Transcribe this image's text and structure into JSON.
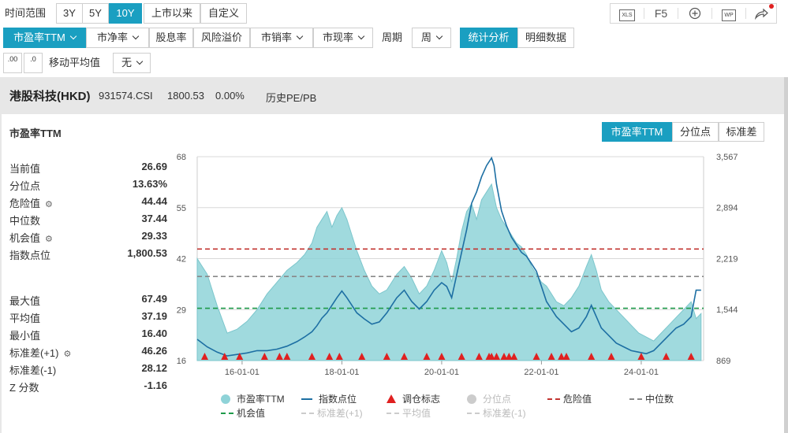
{
  "toolbar": {
    "time_range_label": "时间范围",
    "time_ranges": [
      "3Y",
      "5Y",
      "10Y",
      "上市以来",
      "自定义"
    ],
    "active_range": "10Y",
    "icons": {
      "xls": "XLS",
      "f5": "F5",
      "wp": "WP"
    },
    "metrics": [
      "市盈率TTM",
      "市净率",
      "股息率",
      "风险溢价",
      "市销率",
      "市现率"
    ],
    "period_label": "周期",
    "period_value": "周",
    "view_tabs": [
      "统计分析",
      "明细数据"
    ],
    "decimal_icons": [
      ".00",
      ".0"
    ],
    "ma_label": "移动平均值",
    "ma_value": "无"
  },
  "header": {
    "index_name": "港股科技(HKD)",
    "code": "931574.CSI",
    "price": "1800.53",
    "change": "0.00%",
    "history_link": "历史PE/PB"
  },
  "panel": {
    "title": "市盈率TTM",
    "tabs": [
      "市盈率TTM",
      "分位点",
      "标准差"
    ]
  },
  "stats_top": [
    {
      "label": "当前值",
      "value": "26.69",
      "gear": false
    },
    {
      "label": "分位点",
      "value": "13.63%",
      "gear": false
    },
    {
      "label": "危险值",
      "value": "44.44",
      "gear": true
    },
    {
      "label": "中位数",
      "value": "37.44",
      "gear": false
    },
    {
      "label": "机会值",
      "value": "29.33",
      "gear": true
    },
    {
      "label": "指数点位",
      "value": "1,800.53",
      "gear": false
    }
  ],
  "stats_bottom": [
    {
      "label": "最大值",
      "value": "67.49",
      "gear": false
    },
    {
      "label": "平均值",
      "value": "37.19",
      "gear": false
    },
    {
      "label": "最小值",
      "value": "16.40",
      "gear": false
    },
    {
      "label": "标准差(+1)",
      "value": "46.26",
      "gear": true
    },
    {
      "label": "标准差(-1)",
      "value": "28.12",
      "gear": false
    },
    {
      "label": "Z 分数",
      "value": "-1.16",
      "gear": false
    }
  ],
  "legend": [
    {
      "label": "市盈率TTM",
      "marker": "circle",
      "color": "#8fd3d8",
      "dim": false
    },
    {
      "label": "指数点位",
      "marker": "line",
      "color": "#1d6fa3",
      "dim": false
    },
    {
      "label": "调仓标志",
      "marker": "triangle",
      "color": "#e02020",
      "dim": false
    },
    {
      "label": "分位点",
      "marker": "circle",
      "color": "#cccccc",
      "dim": true
    },
    {
      "label": "危险值",
      "marker": "dash",
      "color": "#c23531",
      "dim": false
    },
    {
      "label": "中位数",
      "marker": "dash",
      "color": "#888888",
      "dim": false
    },
    {
      "label": "机会值",
      "marker": "dash",
      "color": "#1e9a4a",
      "dim": false
    },
    {
      "label": "标准差(+1)",
      "marker": "dash",
      "color": "#cccccc",
      "dim": true
    },
    {
      "label": "平均值",
      "marker": "dash",
      "color": "#cccccc",
      "dim": true
    },
    {
      "label": "标准差(-1)",
      "marker": "dash",
      "color": "#cccccc",
      "dim": true
    }
  ],
  "chart_data": {
    "type": "area",
    "title": "市盈率TTM",
    "x_tick_labels": [
      "16-01-01",
      "18-01-01",
      "20-01-01",
      "22-01-01",
      "24-01-01"
    ],
    "x_tick_years": [
      2016,
      2018,
      2020,
      2022,
      2024
    ],
    "x_range": [
      2015.1,
      2025.25
    ],
    "y_left_range": [
      16,
      68
    ],
    "y_left_ticks": [
      16,
      29,
      42,
      55,
      68
    ],
    "y_right_range": [
      869,
      3567
    ],
    "y_right_ticks": [
      "869",
      "1,544",
      "2,219",
      "2,894",
      "3,567"
    ],
    "grid": true,
    "reference_lines": [
      {
        "name": "危险值",
        "value": 44.44,
        "color": "#c23531"
      },
      {
        "name": "中位数",
        "value": 37.44,
        "color": "#888888"
      },
      {
        "name": "机会值",
        "value": 29.33,
        "color": "#1e9a4a"
      }
    ],
    "series": [
      {
        "name": "市盈率TTM",
        "axis": "left",
        "color": "#8fd3d8",
        "x": [
          2015.1,
          2015.3,
          2015.5,
          2015.7,
          2015.9,
          2016.1,
          2016.3,
          2016.5,
          2016.7,
          2016.9,
          2017.1,
          2017.25,
          2017.4,
          2017.5,
          2017.6,
          2017.7,
          2017.8,
          2017.9,
          2018.0,
          2018.1,
          2018.2,
          2018.3,
          2018.45,
          2018.6,
          2018.75,
          2018.9,
          2019.0,
          2019.1,
          2019.25,
          2019.4,
          2019.55,
          2019.7,
          2019.85,
          2020.0,
          2020.1,
          2020.2,
          2020.3,
          2020.4,
          2020.5,
          2020.6,
          2020.7,
          2020.8,
          2020.9,
          2021.0,
          2021.05,
          2021.1,
          2021.2,
          2021.3,
          2021.4,
          2021.5,
          2021.6,
          2021.7,
          2021.8,
          2021.9,
          2022.0,
          2022.1,
          2022.2,
          2022.3,
          2022.45,
          2022.6,
          2022.75,
          2022.9,
          2023.0,
          2023.1,
          2023.2,
          2023.35,
          2023.5,
          2023.65,
          2023.8,
          2023.95,
          2024.1,
          2024.25,
          2024.4,
          2024.55,
          2024.7,
          2024.85,
          2025.0,
          2025.1,
          2025.2
        ],
        "values": [
          42,
          38,
          30,
          23,
          24,
          26,
          29,
          33,
          36,
          39,
          41,
          43,
          46,
          50,
          52,
          54,
          50,
          53,
          55,
          52,
          48,
          44,
          39,
          35,
          33,
          34,
          36,
          38,
          40,
          37,
          33,
          35,
          39,
          44,
          41,
          36,
          42,
          49,
          54,
          56,
          52,
          57,
          59,
          61,
          58,
          55,
          52,
          50,
          48,
          46,
          45,
          43,
          40,
          38,
          36,
          35,
          33,
          31,
          30,
          32,
          35,
          40,
          43,
          39,
          34,
          31,
          29,
          27,
          25,
          23,
          22,
          21,
          23,
          25,
          27,
          29,
          31,
          26.7,
          28
        ]
      },
      {
        "name": "指数点位",
        "axis": "right",
        "color": "#1d6fa3",
        "x": [
          2015.1,
          2015.3,
          2015.5,
          2015.7,
          2015.9,
          2016.1,
          2016.3,
          2016.5,
          2016.7,
          2016.9,
          2017.1,
          2017.25,
          2017.4,
          2017.5,
          2017.6,
          2017.7,
          2017.8,
          2017.9,
          2018.0,
          2018.1,
          2018.2,
          2018.3,
          2018.45,
          2018.6,
          2018.75,
          2018.9,
          2019.0,
          2019.1,
          2019.25,
          2019.4,
          2019.55,
          2019.7,
          2019.85,
          2020.0,
          2020.1,
          2020.2,
          2020.3,
          2020.4,
          2020.5,
          2020.6,
          2020.7,
          2020.8,
          2020.9,
          2021.0,
          2021.05,
          2021.1,
          2021.2,
          2021.3,
          2021.4,
          2021.5,
          2021.6,
          2021.7,
          2021.8,
          2021.9,
          2022.0,
          2022.1,
          2022.2,
          2022.3,
          2022.45,
          2022.6,
          2022.75,
          2022.9,
          2023.0,
          2023.1,
          2023.2,
          2023.35,
          2023.5,
          2023.65,
          2023.8,
          2023.95,
          2024.1,
          2024.25,
          2024.4,
          2024.55,
          2024.7,
          2024.85,
          2025.0,
          2025.1,
          2025.2
        ],
        "values": [
          1150,
          1050,
          980,
          930,
          950,
          970,
          1000,
          1000,
          1020,
          1060,
          1120,
          1180,
          1250,
          1330,
          1430,
          1500,
          1600,
          1700,
          1790,
          1700,
          1600,
          1500,
          1420,
          1350,
          1380,
          1500,
          1600,
          1700,
          1800,
          1650,
          1550,
          1650,
          1800,
          1900,
          1850,
          1700,
          2000,
          2300,
          2600,
          2950,
          3100,
          3300,
          3450,
          3550,
          3450,
          3200,
          2850,
          2650,
          2500,
          2400,
          2300,
          2250,
          2150,
          2050,
          1850,
          1650,
          1550,
          1450,
          1350,
          1250,
          1300,
          1450,
          1600,
          1450,
          1300,
          1200,
          1100,
          1050,
          1000,
          980,
          960,
          1000,
          1100,
          1200,
          1300,
          1350,
          1450,
          1800,
          1800
        ]
      },
      {
        "name": "调仓标志",
        "axis": "marker",
        "x": [
          2015.25,
          2015.65,
          2015.95,
          2016.45,
          2016.75,
          2016.9,
          2017.4,
          2017.75,
          2017.95,
          2018.4,
          2018.9,
          2019.25,
          2019.7,
          2020.0,
          2020.4,
          2020.75,
          2020.95,
          2021.0,
          2021.1,
          2021.25,
          2021.35,
          2021.45,
          2021.9,
          2022.2,
          2022.4,
          2022.5,
          2023.0,
          2023.4,
          2024.0,
          2024.5,
          2025.0
        ]
      }
    ]
  }
}
